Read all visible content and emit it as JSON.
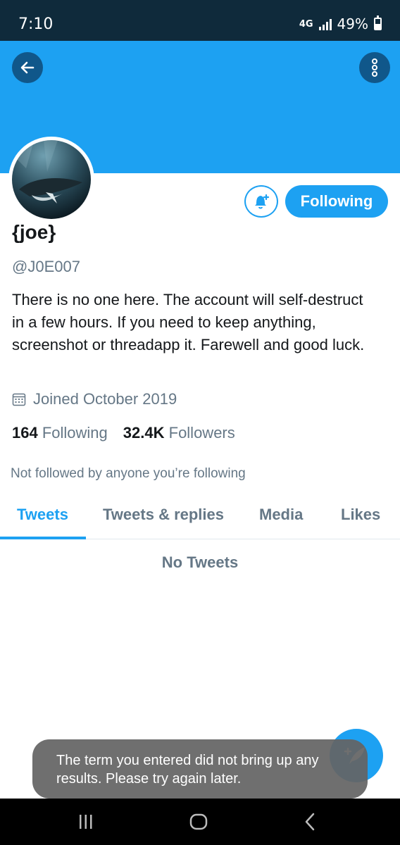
{
  "status_bar": {
    "time": "7:10",
    "network": "4G",
    "battery_text": "49%",
    "battery_level_percent": 49
  },
  "header": {
    "back_icon": "arrow-left-icon",
    "more_icon": "more-vertical-icon"
  },
  "profile": {
    "display_name": "{joe}",
    "handle": "@J0E007",
    "bio": "There is no one here. The account will self-destruct in a few hours. If you need to keep anything, screenshot or threadapp it. Farewell and good luck.",
    "joined": "Joined October 2019",
    "following_count": "164",
    "following_label": "Following",
    "followers_count": "32.4K",
    "followers_label": "Followers",
    "not_followed_text": "Not followed by anyone you’re following",
    "follow_button_label": "Following",
    "notify_icon": "bell-plus-icon"
  },
  "tabs": [
    {
      "label": "Tweets",
      "active": true
    },
    {
      "label": "Tweets & replies",
      "active": false
    },
    {
      "label": "Media",
      "active": false
    },
    {
      "label": "Likes",
      "active": false
    }
  ],
  "content": {
    "empty_text": "No Tweets"
  },
  "toast": {
    "message": "The term you entered did not bring up any results. Please try again later."
  },
  "fab": {
    "icon": "compose-tweet-icon"
  },
  "nav_bar": {
    "items": [
      "recent-apps-icon",
      "home-icon",
      "back-icon"
    ]
  },
  "colors": {
    "accent": "#1da1f2",
    "status_bar": "#0f2a3b",
    "secondary_text": "#657786"
  }
}
